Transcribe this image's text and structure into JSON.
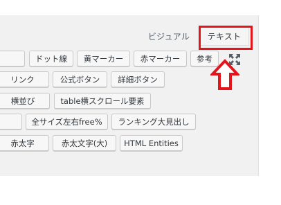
{
  "editor_tabs": {
    "visual_label": "ビジュアル",
    "text_label": "テキスト"
  },
  "quicktags": {
    "row1": [
      "",
      "ドット線",
      "黄マーカー",
      "赤マーカー",
      "参考"
    ],
    "row2": [
      "リンク",
      "公式ボタン",
      "詳細ボタン"
    ],
    "row3": [
      "横並び",
      "table横スクロール要素"
    ],
    "row4": [
      "",
      "全サイズ左右free%",
      "ランキング大見出し"
    ],
    "row5": [
      "赤太字",
      "赤太文字(大)",
      "HTML Entities"
    ]
  },
  "colors": {
    "highlight": "#e4141b",
    "panel": "#f1f1f1"
  }
}
